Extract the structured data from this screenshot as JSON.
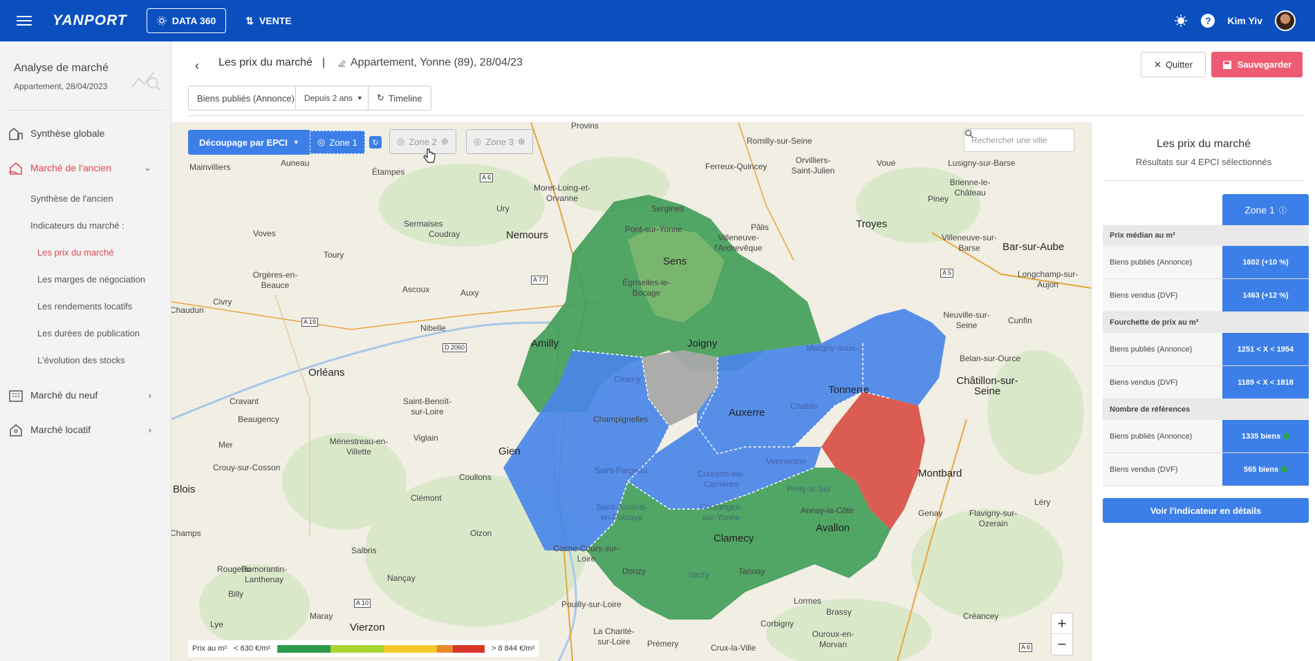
{
  "topbar": {
    "logo": "YANPORT",
    "data360_label": "DATA 360",
    "vente_label": "VENTE",
    "help": "?",
    "user_name": "Kim Yiv"
  },
  "sidebar": {
    "title": "Analyse de marché",
    "subtitle": "Appartement, 28/04/2023",
    "items": [
      {
        "label": "Synthèse globale",
        "icon": "building-chart-icon"
      },
      {
        "label": "Marché de l'ancien",
        "icon": "house-hand-icon"
      },
      {
        "label": "Marché du neuf",
        "icon": "office-building-icon"
      },
      {
        "label": "Marché locatif",
        "icon": "house-person-icon"
      }
    ],
    "subitems": [
      {
        "label": "Synthèse de l'ancien"
      },
      {
        "label": "Indicateurs du marché :"
      },
      {
        "label": "Les prix du marché"
      },
      {
        "label": "Les marges de négociation"
      },
      {
        "label": "Les rendements locatifs"
      },
      {
        "label": "Les durées de publication"
      },
      {
        "label": "L'évolution des stocks"
      }
    ]
  },
  "header": {
    "page_title": "Les prix du marché",
    "separator": "|",
    "subject": "Appartement, Yonne (89), 28/04/23",
    "quit_label": "Quitter",
    "save_label": "Sauvegarder",
    "filters": [
      {
        "label": "Biens publiés (Annonce)"
      },
      {
        "label": "Depuis 2 ans"
      },
      {
        "label": "Timeline"
      }
    ]
  },
  "map": {
    "epci_label": "Découpage par EPCI",
    "zone1_label": "Zone 1",
    "zone2_label": "Zone 2",
    "zone3_label": "Zone 3",
    "search_placeholder": "Rechercher une ville",
    "zoom_in": "+",
    "zoom_out": "−",
    "legend": {
      "title": "Prix au m²",
      "min": "< 630 €/m²",
      "max": "> 8 844 €/m²",
      "colors": [
        "#2e9b4a",
        "#a7d630",
        "#f4c92a",
        "#e78a2f",
        "#d9362b"
      ]
    },
    "places": [
      "Provins",
      "Romilly-sur-Seine",
      "Mainvilliers",
      "Auneau",
      "Étampes",
      "Moret-Loing-et-Orvanne",
      "Ferreux-Quincey",
      "Orvilliers-Saint-Julien",
      "Voué",
      "Lusigny-sur-Barse",
      "Brienne-le-Château",
      "Ury",
      "Sergines",
      "Pont-sur-Yonne",
      "Nemours",
      "Sermaises",
      "Coudray",
      "Pâlis",
      "Troyes",
      "Piney",
      "Voves",
      "Toury",
      "Villeneuve-l'Archevêque",
      "Villeneuve-sur-Barse",
      "Bar-sur-Aube",
      "Orgères-en-Beauce",
      "Ascoux",
      "Auxy",
      "Sens",
      "Égriselles-le-Bocage",
      "Longchamp-sur-Aujon",
      "Chaudun",
      "Civry",
      "Nibelle",
      "Neuville-sur-Seine",
      "Cunfin",
      "Amilly",
      "Joigny",
      "Maligny-sous-...",
      "Orléans",
      "Charny",
      "Belan-sur-Ource",
      "Châtillon-sur-Seine",
      "Cravant",
      "Saint-Benoît-sur-Loire",
      "Tonnerre",
      "Beaugency",
      "Champignelles",
      "Auxerre",
      "Chablis",
      "Ménestreau-en-Villette",
      "Viglain",
      "Gien",
      "Mer",
      "Saint-Fargeau",
      "Vermenton",
      "Montbard",
      "Crouy-sur-Cosson",
      "Coullons",
      "Courson-les-Carrières",
      "Blois",
      "Clémont",
      "Saint-Amand-en-Puisaye",
      "Coulanges-sur-Yonne",
      "Annay-la-Côte",
      "Genay",
      "Flavigny-sur-Ozerain",
      "Léry",
      "Champs",
      "Oizon",
      "Clamecy",
      "Avallon",
      "Salbris",
      "Cosne-Cours-sur-Loire",
      "Romorantin-Lanthenay",
      "Rougeou",
      "Nançay",
      "Donzy",
      "Tannay",
      "Varzy",
      "Billy",
      "Lormes",
      "Brassy",
      "Maray",
      "Vierzon",
      "Pouilly-sur-Loire",
      "Créancey",
      "Lye",
      "Corbigny",
      "La Charité-sur-Loire",
      "Prémery",
      "Crux-la-Ville",
      "Ouroux-en-Morvan",
      "Préty-le-Sel"
    ],
    "roads": [
      "A 6",
      "A 77",
      "A 19",
      "D 2060",
      "A 5",
      "A 10",
      "A 6"
    ]
  },
  "panel": {
    "title": "Les prix du marché",
    "subtitle": "Résultats sur 4 EPCI sélectionnés",
    "zone_tab": "Zone 1",
    "sections": [
      {
        "title": "Prix médian au m²",
        "rows": [
          {
            "label": "Biens publiés (Annonce)",
            "value": "1602 (+10 %)"
          },
          {
            "label": "Biens vendus (DVF)",
            "value": "1463 (+12 %)"
          }
        ]
      },
      {
        "title": "Fourchette de prix au m²",
        "rows": [
          {
            "label": "Biens publiés (Annonce)",
            "value": "1251 < X < 1954"
          },
          {
            "label": "Biens vendus (DVF)",
            "value": "1189 < X < 1818"
          }
        ]
      },
      {
        "title": "Nombre de références",
        "rows": [
          {
            "label": "Biens publiés (Annonce)",
            "value": "1335 biens"
          },
          {
            "label": "Biens vendus (DVF)",
            "value": "565 biens"
          }
        ]
      }
    ],
    "detail_button": "Voir l'indicateur en détails"
  }
}
